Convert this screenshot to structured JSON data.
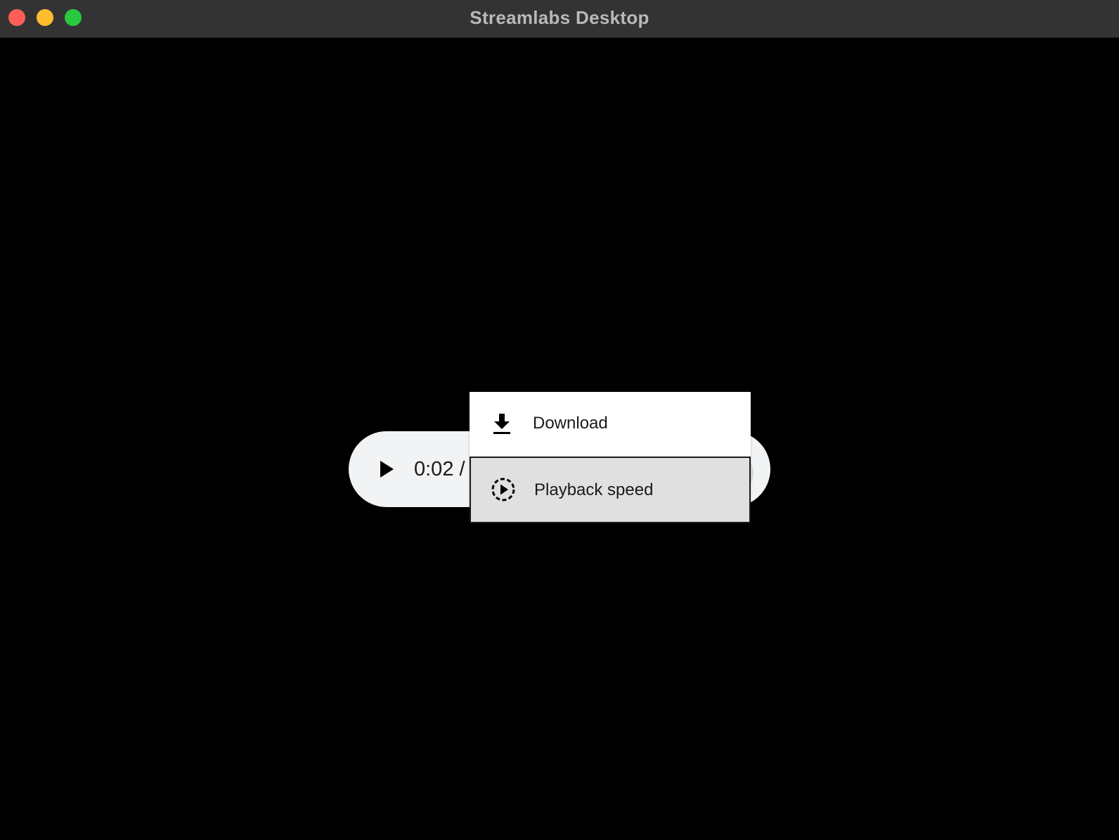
{
  "window": {
    "title": "Streamlabs Desktop"
  },
  "player": {
    "time_display": "0:02 /",
    "play_icon": "play-icon"
  },
  "overflow_menu": {
    "items": [
      {
        "label": "Download",
        "icon": "download-icon"
      },
      {
        "label": "Playback speed",
        "icon": "playback-speed-icon",
        "highlighted": true
      }
    ]
  },
  "colors": {
    "titlebar": "#333333",
    "close": "#ff5f57",
    "minimize": "#febc2e",
    "maximize": "#28c840",
    "controls_bg": "#f1f3f4",
    "menu_bg": "#ffffff",
    "menu_highlight": "#e0e0e0"
  }
}
